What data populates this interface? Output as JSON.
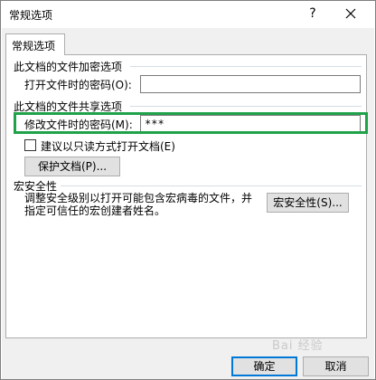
{
  "window": {
    "title": "常规选项",
    "help": "?",
    "close": "✕"
  },
  "tab": {
    "label": "常规选项"
  },
  "encrypt_group": {
    "title": "此文档的文件加密选项",
    "open_password_label": "打开文件时的密码(O):",
    "open_password_value": ""
  },
  "share_group": {
    "title": "此文档的文件共享选项",
    "modify_password_label": "修改文件时的密码(M):",
    "modify_password_value": "***",
    "readonly_label": "建议以只读方式打开文档(E)",
    "protect_button": "保护文档(P)..."
  },
  "macro_group": {
    "title": "宏安全性",
    "desc_line1": "调整安全级别以打开可能包含宏病毒的文件，并",
    "desc_line2": "指定可信任的宏创建者姓名。",
    "macro_button": "宏安全性(S)..."
  },
  "footer": {
    "ok": "确定",
    "cancel": "取消"
  },
  "watermark": "Bai 经验"
}
